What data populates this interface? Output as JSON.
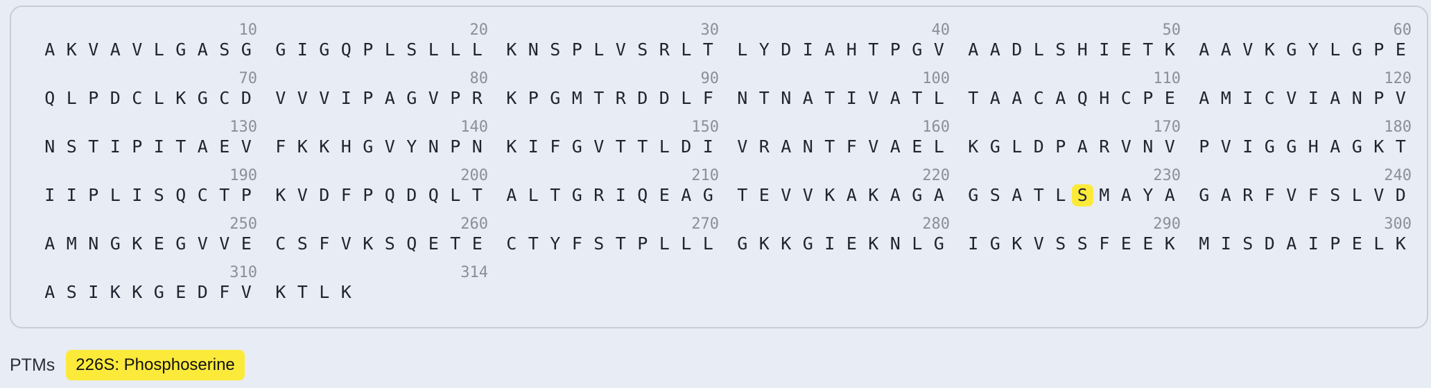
{
  "sequence": {
    "blocks": [
      {
        "num": "10",
        "seq": "AKVAVLGASG"
      },
      {
        "num": "20",
        "seq": "GIGQPLSLLL"
      },
      {
        "num": "30",
        "seq": "KNSPLVSRLT"
      },
      {
        "num": "40",
        "seq": "LYDIAHTPGV"
      },
      {
        "num": "50",
        "seq": "AADLSHIETK"
      },
      {
        "num": "60",
        "seq": "AAVKGYLGPE"
      },
      {
        "num": "70",
        "seq": "QLPDCLKGCD"
      },
      {
        "num": "80",
        "seq": "VVVIPAGVPR"
      },
      {
        "num": "90",
        "seq": "KPGMTRDDLF"
      },
      {
        "num": "100",
        "seq": "NTNATIVATL"
      },
      {
        "num": "110",
        "seq": "TAACAQHCPE"
      },
      {
        "num": "120",
        "seq": "AMICVIANPV"
      },
      {
        "num": "130",
        "seq": "NSTIPITAEV"
      },
      {
        "num": "140",
        "seq": "FKKHGVYNPN"
      },
      {
        "num": "150",
        "seq": "KIFGVTTLDI"
      },
      {
        "num": "160",
        "seq": "VRANTFVAEL"
      },
      {
        "num": "170",
        "seq": "KGLDPARVNV"
      },
      {
        "num": "180",
        "seq": "PVIGGHAGKT"
      },
      {
        "num": "190",
        "seq": "IIPLISQCTP"
      },
      {
        "num": "200",
        "seq": "KVDFPQDQLT"
      },
      {
        "num": "210",
        "seq": "ALTGRIQEAG"
      },
      {
        "num": "220",
        "seq": "TEVVKAKAGA"
      },
      {
        "num": "230",
        "seq": "GSATLSMAYA",
        "highlight_index": 5
      },
      {
        "num": "240",
        "seq": "GARFVFSLVD"
      },
      {
        "num": "250",
        "seq": "AMNGKEGVVE"
      },
      {
        "num": "260",
        "seq": "CSFVKSQETE"
      },
      {
        "num": "270",
        "seq": "CTYFSTPLLL"
      },
      {
        "num": "280",
        "seq": "GKKGIEKNLG"
      },
      {
        "num": "290",
        "seq": "IGKVSSFEEK"
      },
      {
        "num": "300",
        "seq": "MISDAIPELK"
      },
      {
        "num": "310",
        "seq": "ASIKKGEDFV"
      },
      {
        "num": "314",
        "seq": "KTLK"
      }
    ]
  },
  "ptms": {
    "label": "PTMs",
    "items": [
      {
        "text": "226S: Phosphoserine",
        "color": "#fcea3b"
      }
    ]
  },
  "colors": {
    "background": "#e8ecf4",
    "highlight": "#fcea3b",
    "number": "#8a8f98",
    "residue": "#1f2430"
  }
}
